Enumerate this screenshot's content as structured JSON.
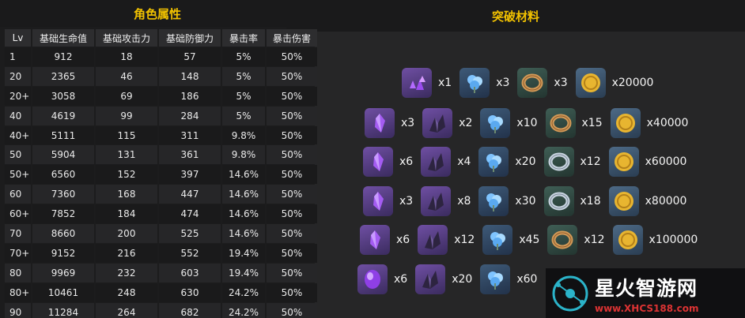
{
  "headers": {
    "stats": "角色属性",
    "materials": "突破材料"
  },
  "columns": [
    "Lv",
    "基础生命值",
    "基础攻击力",
    "基础防御力",
    "暴击率",
    "暴击伤害"
  ],
  "rows": [
    [
      "1",
      "912",
      "18",
      "57",
      "5%",
      "50%"
    ],
    [
      "20",
      "2365",
      "46",
      "148",
      "5%",
      "50%"
    ],
    [
      "20+",
      "3058",
      "69",
      "186",
      "5%",
      "50%"
    ],
    [
      "40",
      "4619",
      "99",
      "284",
      "5%",
      "50%"
    ],
    [
      "40+",
      "5111",
      "115",
      "311",
      "9.8%",
      "50%"
    ],
    [
      "50",
      "5904",
      "131",
      "361",
      "9.8%",
      "50%"
    ],
    [
      "50+",
      "6560",
      "152",
      "397",
      "14.6%",
      "50%"
    ],
    [
      "60",
      "7360",
      "168",
      "447",
      "14.6%",
      "50%"
    ],
    [
      "60+",
      "7852",
      "184",
      "474",
      "14.6%",
      "50%"
    ],
    [
      "70",
      "8660",
      "200",
      "525",
      "14.6%",
      "50%"
    ],
    [
      "70+",
      "9152",
      "216",
      "552",
      "19.4%",
      "50%"
    ],
    [
      "80",
      "9969",
      "232",
      "603",
      "19.4%",
      "50%"
    ],
    [
      "80+",
      "10461",
      "248",
      "630",
      "24.2%",
      "50%"
    ],
    [
      "90",
      "11284",
      "264",
      "682",
      "24.2%",
      "50%"
    ]
  ],
  "materials": [
    [
      {
        "icon": "purple-crystal-cluster-icon",
        "qty": "x1"
      },
      {
        "icon": "blue-flower-icon",
        "qty": "x3"
      },
      {
        "icon": "bronze-ring-icon",
        "qty": "x3"
      },
      {
        "icon": "gold-coin-icon",
        "qty": "x20000"
      }
    ],
    [
      {
        "icon": "purple-crystal-icon",
        "qty": "x3"
      },
      {
        "icon": "dark-shard-icon",
        "qty": "x2"
      },
      {
        "icon": "blue-flower-icon",
        "qty": "x10"
      },
      {
        "icon": "bronze-ring-icon",
        "qty": "x15"
      },
      {
        "icon": "gold-coin-icon",
        "qty": "x40000"
      }
    ],
    [
      {
        "icon": "purple-crystal-icon",
        "qty": "x6"
      },
      {
        "icon": "dark-shard-icon",
        "qty": "x4"
      },
      {
        "icon": "blue-flower-icon",
        "qty": "x20"
      },
      {
        "icon": "silver-ring-icon",
        "qty": "x12"
      },
      {
        "icon": "gold-coin-icon",
        "qty": "x60000"
      }
    ],
    [
      {
        "icon": "purple-crystal-icon",
        "qty": "x3"
      },
      {
        "icon": "dark-shard-icon",
        "qty": "x8"
      },
      {
        "icon": "blue-flower-icon",
        "qty": "x30"
      },
      {
        "icon": "silver-ring-icon",
        "qty": "x18"
      },
      {
        "icon": "gold-coin-icon",
        "qty": "x80000"
      }
    ],
    [
      {
        "icon": "purple-crystal-icon",
        "qty": "x6"
      },
      {
        "icon": "dark-shard-icon",
        "qty": "x12"
      },
      {
        "icon": "blue-flower-icon",
        "qty": "x45"
      },
      {
        "icon": "bronze-ring-icon",
        "qty": "x12"
      },
      {
        "icon": "gold-coin-icon",
        "qty": "x100000"
      }
    ],
    [
      {
        "icon": "purple-gem-icon",
        "qty": "x6"
      },
      {
        "icon": "dark-shard-icon",
        "qty": "x20"
      },
      {
        "icon": "blue-flower-icon",
        "qty": "x60"
      }
    ]
  ],
  "watermark": {
    "title": "星火智游网",
    "url": "www.XHCS188.com"
  }
}
